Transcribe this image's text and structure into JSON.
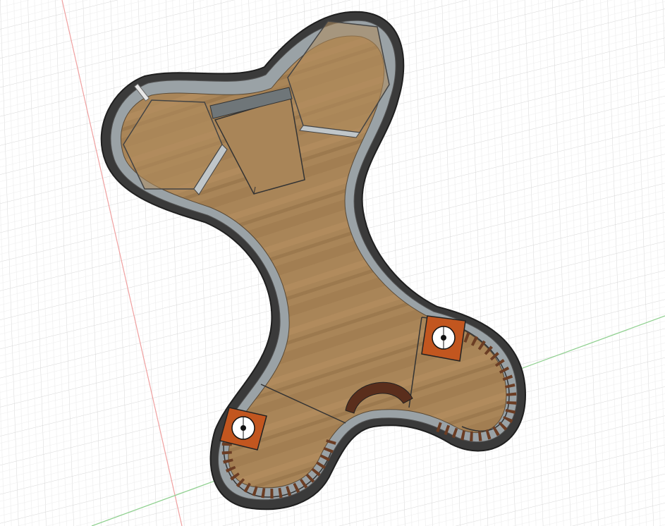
{
  "viewport": {
    "background": "#ffffff",
    "grid_color": "#dcdcdc",
    "grid_major_color": "#c8c8c8",
    "axis_x_color": "#8fd08f",
    "axis_y_color": "#f0a0a0"
  },
  "model": {
    "floor_color": "#a98558",
    "floor_dark": "#8a6a40",
    "wall_color": "#9aa2a6",
    "wall_dark": "#2e2e2e",
    "fixture_color": "#c2561f",
    "fixture_icon": "circle-target-icon",
    "rail_color": "#6b3d24",
    "fixtures": [
      "fixture-top-right",
      "fixture-bottom-left"
    ]
  }
}
